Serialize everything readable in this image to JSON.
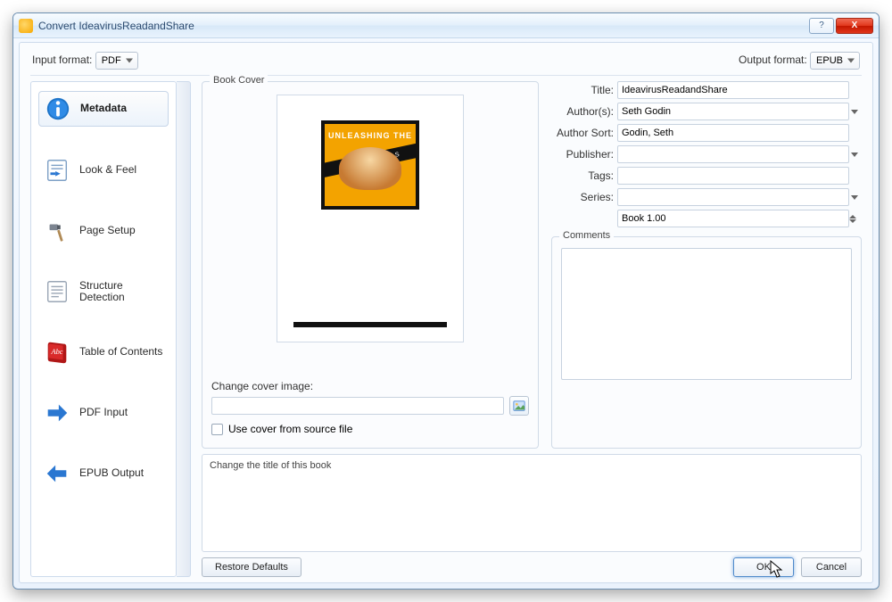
{
  "window": {
    "title": "Convert IdeavirusReadandShare",
    "help_tooltip": "?",
    "close_tooltip": "X"
  },
  "formats": {
    "input_label": "Input format:",
    "input_value": "PDF",
    "output_label": "Output format:",
    "output_value": "EPUB"
  },
  "sidebar": {
    "items": [
      {
        "label": "Metadata"
      },
      {
        "label": "Look & Feel"
      },
      {
        "label": "Page Setup"
      },
      {
        "label": "Structure Detection"
      },
      {
        "label": "Table of Contents"
      },
      {
        "label": "PDF Input"
      },
      {
        "label": "EPUB Output"
      }
    ]
  },
  "cover": {
    "group_title": "Book Cover",
    "thumb_top_text": "UNLEASHING THE",
    "thumb_banner": "IDEAVIRUS",
    "change_label": "Change cover image:",
    "change_path": "",
    "use_source_label": "Use cover from source file"
  },
  "meta": {
    "title_label": "Title:",
    "title_value": "IdeavirusReadandShare",
    "authors_label": "Author(s):",
    "authors_value": "Seth Godin",
    "authorsort_label": "Author Sort:",
    "authorsort_value": "Godin, Seth",
    "publisher_label": "Publisher:",
    "publisher_value": "",
    "tags_label": "Tags:",
    "tags_value": "",
    "series_label": "Series:",
    "series_value": "",
    "series_index": "Book 1.00",
    "comments_label": "Comments"
  },
  "help": {
    "text": "Change the title of this book"
  },
  "buttons": {
    "restore": "Restore Defaults",
    "ok": "OK",
    "cancel": "Cancel"
  }
}
